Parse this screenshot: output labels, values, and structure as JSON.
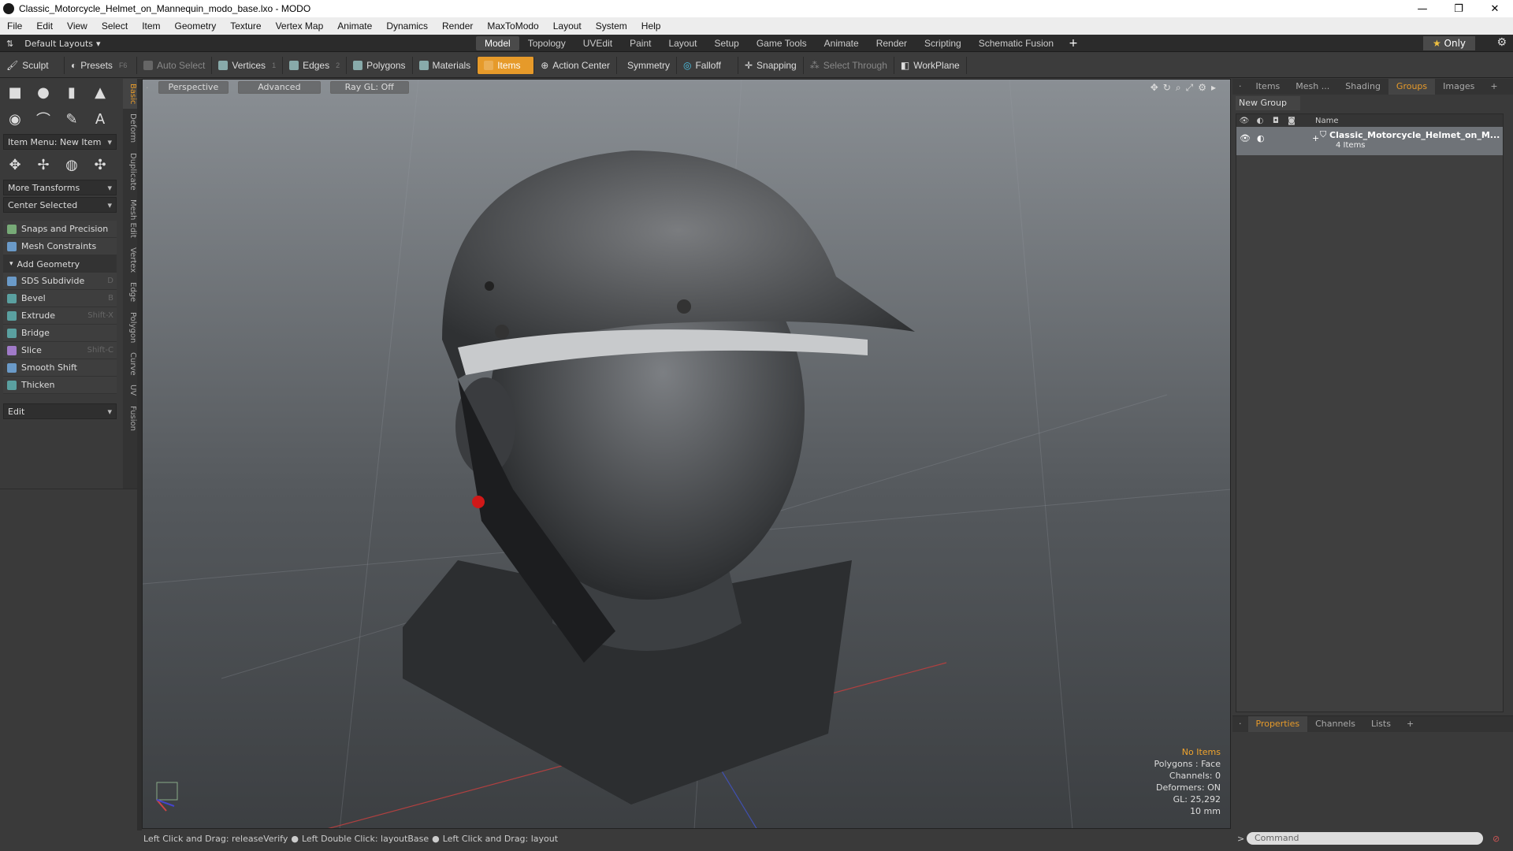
{
  "window": {
    "title": "Classic_Motorcycle_Helmet_on_Mannequin_modo_base.lxo - MODO"
  },
  "menu": [
    "File",
    "Edit",
    "View",
    "Select",
    "Item",
    "Geometry",
    "Texture",
    "Vertex Map",
    "Animate",
    "Dynamics",
    "Render",
    "MaxToModo",
    "Layout",
    "System",
    "Help"
  ],
  "layoutbar": {
    "layout": "Default Layouts",
    "tabs": [
      "Model",
      "Topology",
      "UVEdit",
      "Paint",
      "Layout",
      "Setup",
      "Game Tools",
      "Animate",
      "Render",
      "Scripting",
      "Schematic Fusion"
    ],
    "active_tab": "Model",
    "only_label": "Only"
  },
  "toolbar": {
    "sculpt": "Sculpt",
    "presets": "Presets",
    "presets_key": "F6",
    "auto_select": "Auto Select",
    "vertices": "Vertices",
    "vertices_key": "1",
    "edges": "Edges",
    "edges_key": "2",
    "polygons": "Polygons",
    "materials": "Materials",
    "items": "Items",
    "action_center": "Action Center",
    "symmetry": "Symmetry",
    "falloff": "Falloff",
    "snapping": "Snapping",
    "select_through": "Select Through",
    "workplane": "WorkPlane"
  },
  "leftpanel": {
    "item_menu": "Item Menu: New Item",
    "more_transforms": "More Transforms",
    "center_selected": "Center Selected",
    "snaps": "Snaps and Precision",
    "mesh_constraints": "Mesh Constraints",
    "add_geometry": "Add Geometry",
    "tools": [
      {
        "label": "SDS Subdivide",
        "key": "D"
      },
      {
        "label": "Bevel",
        "key": "B"
      },
      {
        "label": "Extrude",
        "key": "Shift-X"
      },
      {
        "label": "Bridge",
        "key": ""
      },
      {
        "label": "Slice",
        "key": "Shift-C"
      },
      {
        "label": "Smooth Shift",
        "key": ""
      },
      {
        "label": "Thicken",
        "key": ""
      }
    ],
    "edit": "Edit",
    "vtabs": [
      "Basic",
      "Deform",
      "Duplicate",
      "Mesh Edit",
      "Vertex",
      "Edge",
      "Polygon",
      "Curve",
      "UV",
      "Fusion"
    ]
  },
  "viewport": {
    "perspective": "Perspective",
    "advanced": "Advanced",
    "raygl": "Ray GL: Off",
    "stats": {
      "no_items": "No Items",
      "polygons": "Polygons : Face",
      "channels": "Channels: 0",
      "deformers": "Deformers: ON",
      "gl": "GL: 25,292",
      "scale": "10 mm"
    }
  },
  "statusbar": {
    "hint1": "Left Click and Drag: releaseVerify",
    "hint2": "Left Double Click: layoutBase",
    "hint3": "Left Click and Drag: layout"
  },
  "rightpanel": {
    "tabs": [
      "Items",
      "Mesh ...",
      "Shading",
      "Groups",
      "Images"
    ],
    "active_tab": "Groups",
    "new_group": "New Group",
    "col_name": "Name",
    "group_name": "Classic_Motorcycle_Helmet_on_M...",
    "group_count": "4 Items"
  },
  "propspanel": {
    "tabs": [
      "Properties",
      "Channels",
      "Lists"
    ],
    "active_tab": "Properties",
    "command_placeholder": "Command"
  }
}
